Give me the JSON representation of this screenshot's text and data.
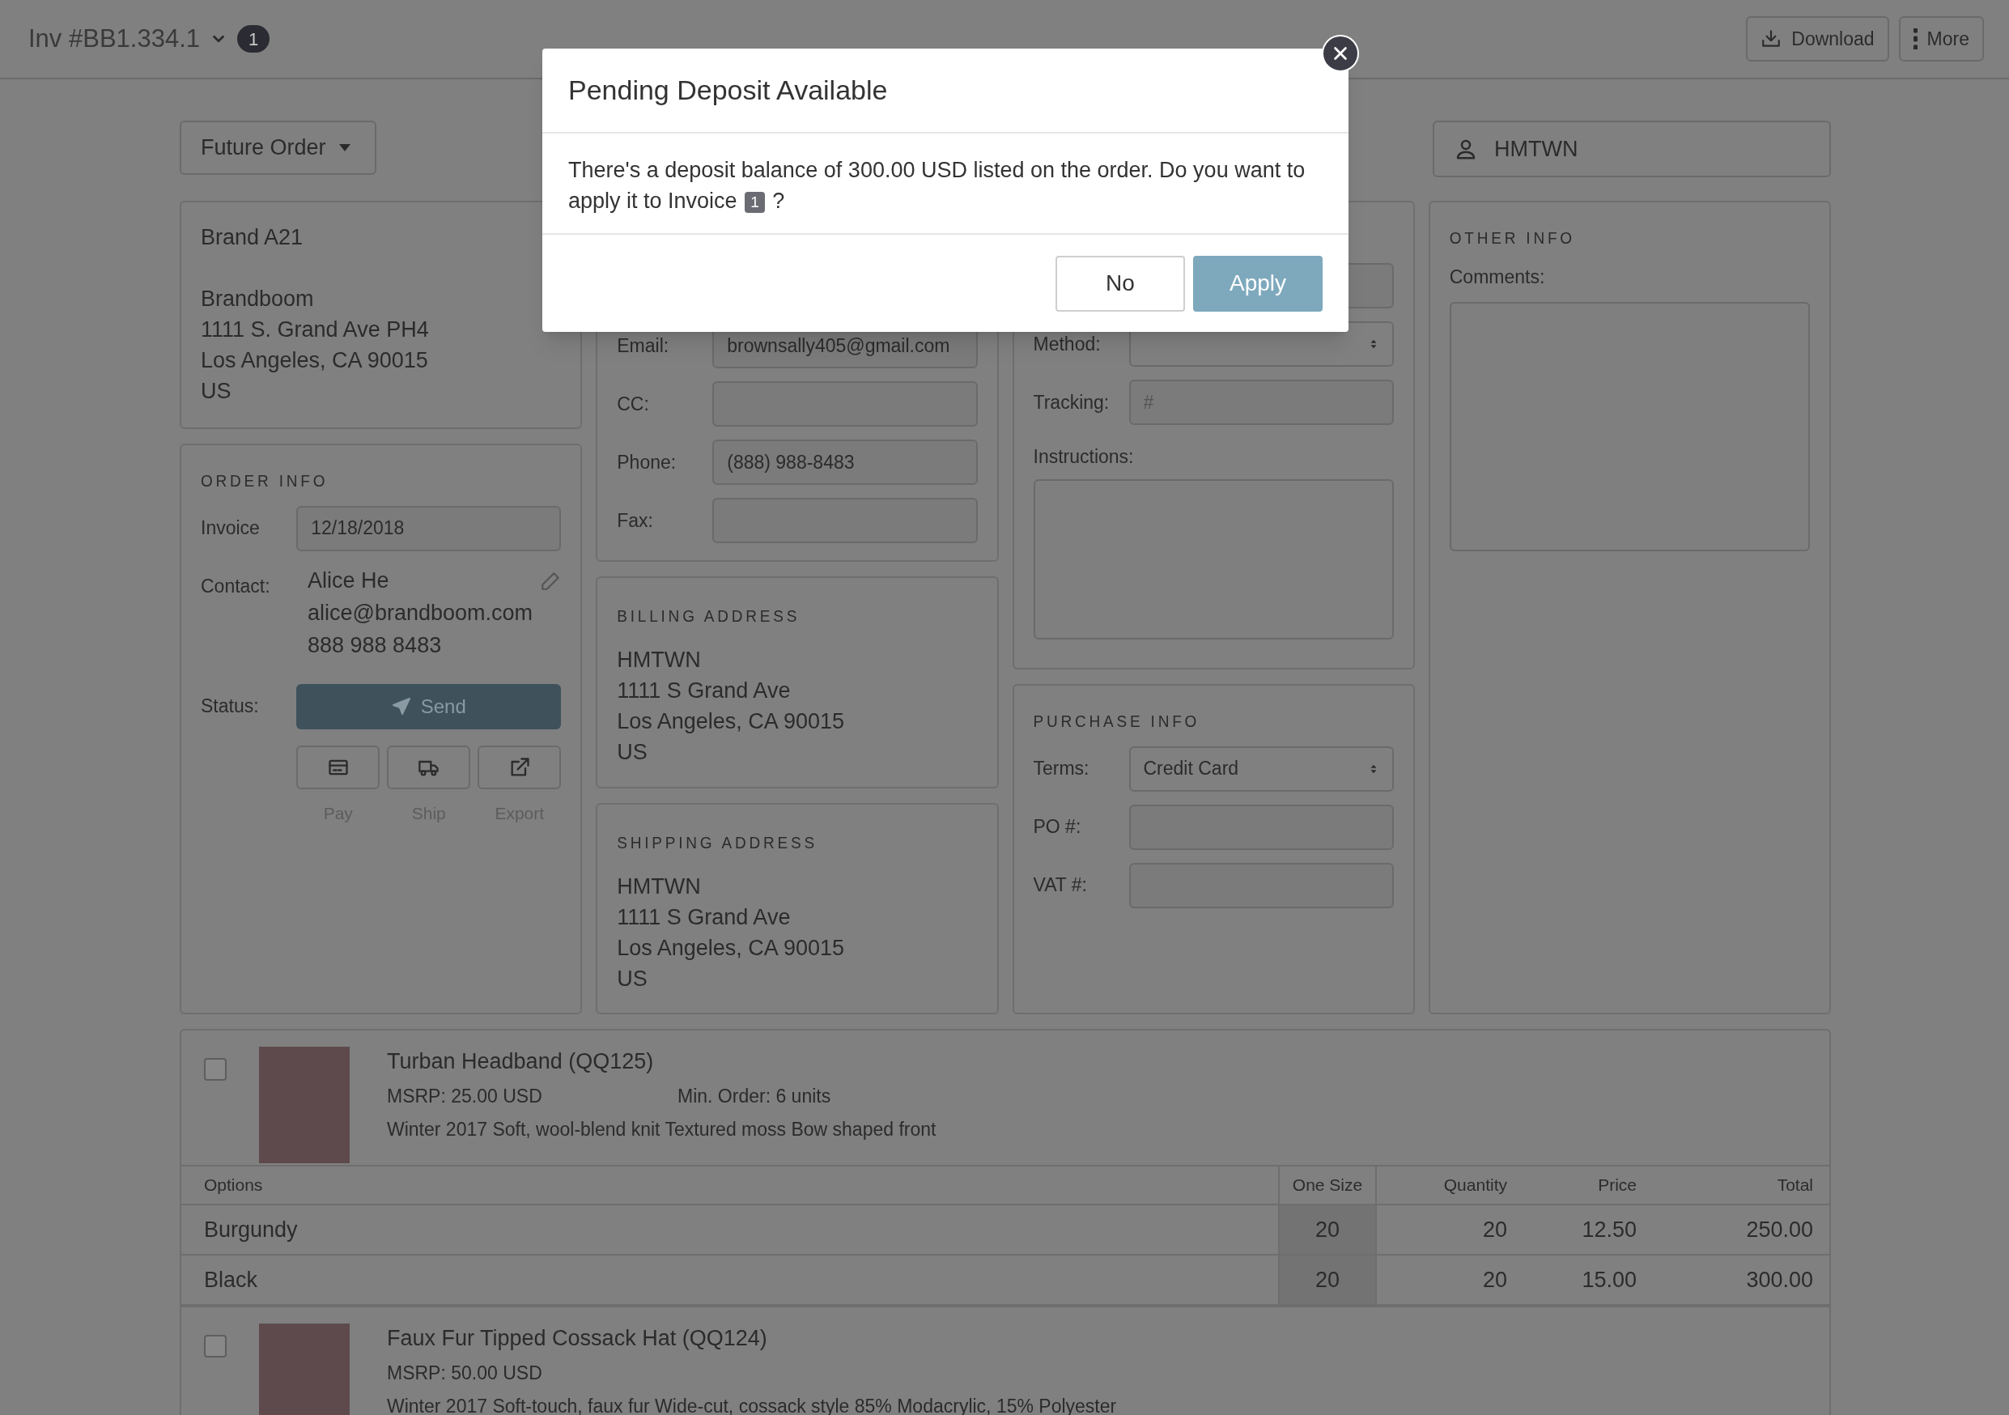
{
  "header": {
    "title": "Inv #BB1.334.1",
    "badge": "1",
    "buttons": [
      {
        "label": "Download",
        "kind": "download"
      },
      {
        "label": "More",
        "kind": "more"
      }
    ]
  },
  "order_type": {
    "value": "Future Order"
  },
  "customer": {
    "value": "HMTWN"
  },
  "brand_card": {
    "name": "Brand A21",
    "address": [
      "Brandboom",
      "1111 S. Grand Ave PH4",
      "Los Angeles, CA 90015",
      "US"
    ]
  },
  "order_info": {
    "heading": "ORDER INFO",
    "invoice_label": "Invoice",
    "invoice_value": "12/18/2018",
    "contact_label": "Contact:",
    "contact_lines": [
      "Alice He",
      "alice@brandboom.com",
      "888 988 8483"
    ],
    "status_label": "Status:",
    "send_label": "Send",
    "actions": [
      {
        "label": "Pay",
        "kind": "pay"
      },
      {
        "label": "Ship",
        "kind": "ship"
      },
      {
        "label": "Export",
        "kind": "export"
      }
    ]
  },
  "contact_card": {
    "fields": [
      {
        "label": "Email:",
        "value": "brownsally405@gmail.com"
      },
      {
        "label": "CC:"
      },
      {
        "label": "Phone:",
        "value": "(888) 988-8483"
      },
      {
        "label": "Fax:"
      }
    ]
  },
  "billing_address": {
    "heading": "BILLING ADDRESS",
    "lines": [
      "HMTWN",
      "1111 S Grand Ave",
      "Los Angeles, CA 90015",
      "US"
    ]
  },
  "shipping_address": {
    "heading": "SHIPPING ADDRESS",
    "lines": [
      "HMTWN",
      "1111 S Grand Ave",
      "Los Angeles, CA 90015",
      "US"
    ]
  },
  "shipping_info": {
    "fields": [
      {
        "kind": "input"
      },
      {
        "kind": "select",
        "label": "Method:"
      },
      {
        "kind": "input",
        "label": "Tracking:",
        "placeholder": "#"
      },
      {
        "kind": "textarea",
        "label": "Instructions:"
      }
    ]
  },
  "purchase_info": {
    "heading": "PURCHASE INFO",
    "fields": [
      {
        "kind": "select",
        "label": "Terms:",
        "value": "Credit Card"
      },
      {
        "kind": "input",
        "label": "PO #:"
      },
      {
        "kind": "input",
        "label": "VAT #:"
      }
    ]
  },
  "other_info": {
    "heading": "OTHER INFO",
    "comments_label": "Comments:"
  },
  "products": [
    {
      "checked": false,
      "name": "Turban Headband (QQ125)",
      "msrp": "MSRP: 25.00 USD",
      "min_order": "Min. Order: 6 units",
      "description": "Winter 2017 Soft, wool-blend knit Textured moss Bow shaped front",
      "table": {
        "columns": [
          "Options",
          "One Size",
          "Quantity",
          "Price",
          "Total"
        ],
        "rows": [
          [
            "Burgundy",
            "20",
            "20",
            "12.50",
            "250.00"
          ],
          [
            "Black",
            "20",
            "20",
            "15.00",
            "300.00"
          ]
        ]
      }
    },
    {
      "checked": false,
      "name": "Faux Fur Tipped Cossack Hat (QQ124)",
      "msrp": "MSRP: 50.00 USD",
      "description": "Winter 2017 Soft-touch, faux fur Wide-cut, cossack style 85% Modacrylic, 15% Polyester"
    }
  ],
  "modal": {
    "title": "Pending Deposit Available",
    "message": "There's a deposit balance of 300.00 USD listed on the order. Do you want to apply it to Invoice",
    "badge": "1",
    "message_end": "?",
    "buttons": [
      {
        "label": "No",
        "kind": "secondary"
      },
      {
        "label": "Apply",
        "kind": "primary"
      }
    ]
  }
}
